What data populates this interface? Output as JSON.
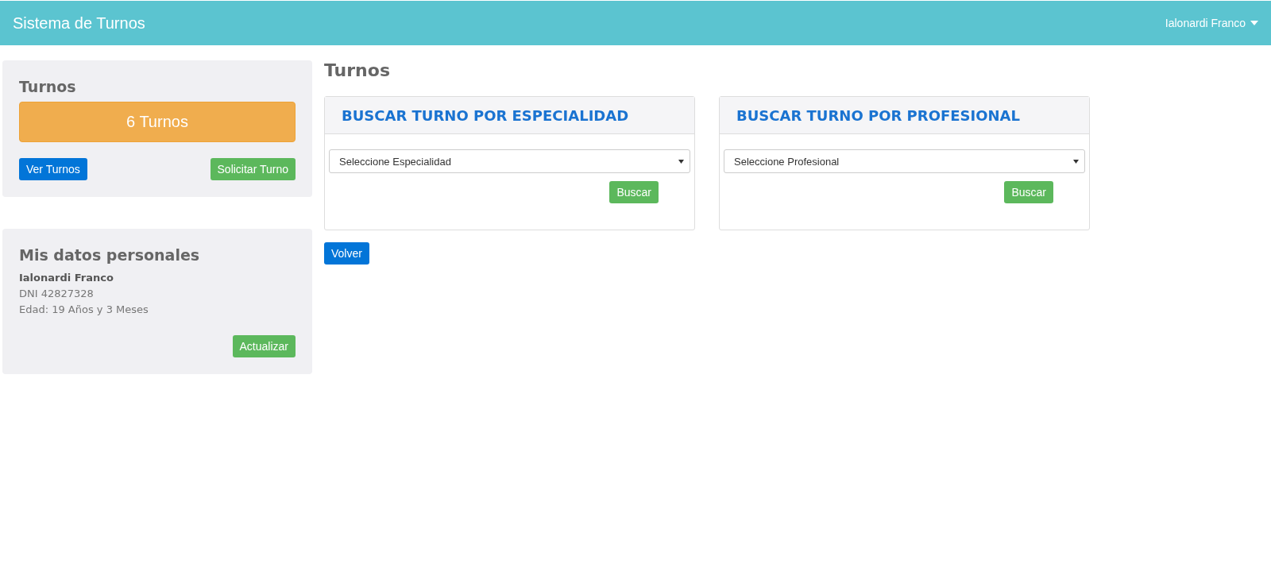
{
  "navbar": {
    "brand": "Sistema de Turnos",
    "user": "Ialonardi Franco"
  },
  "turnos_panel": {
    "title": "Turnos",
    "count": "6 Turnos",
    "buttons": [
      {
        "label": "Ver Turnos",
        "kind": "primary"
      },
      {
        "label": "Solicitar Turno",
        "kind": "success"
      }
    ]
  },
  "personal_panel": {
    "title": "Mis datos personales",
    "name": "Ialonardi Franco",
    "dni": "DNI 42827328",
    "age": "Edad: 19 Años y 3 Meses",
    "button": {
      "label": "Actualizar",
      "kind": "success"
    }
  },
  "page_title": "Turnos",
  "search_cards": [
    {
      "title": "BUSCAR TURNO POR ESPECIALIDAD",
      "select": "Seleccione Especialidad",
      "button": {
        "label": "Buscar",
        "kind": "success"
      }
    },
    {
      "title": "BUSCAR TURNO POR PROFESIONAL",
      "select": "Seleccione Profesional",
      "button": {
        "label": "Buscar",
        "kind": "success"
      }
    }
  ],
  "back_button": {
    "label": "Volver",
    "kind": "primary"
  }
}
